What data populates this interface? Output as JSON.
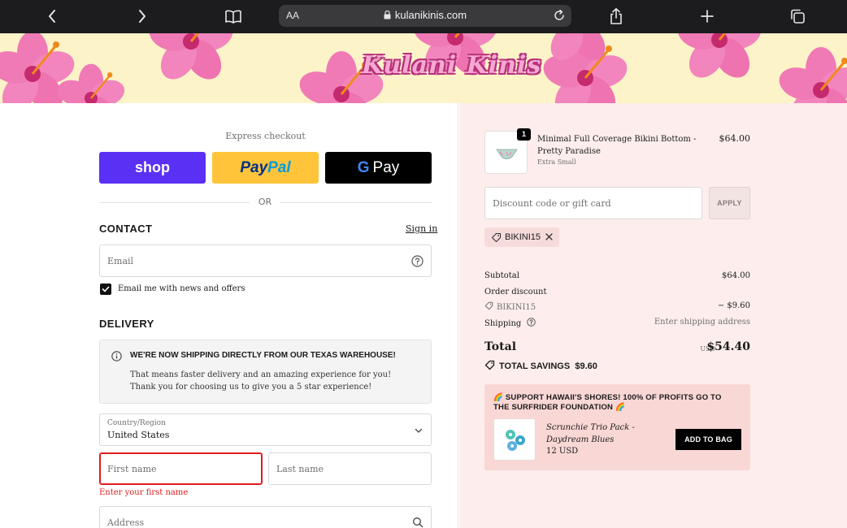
{
  "browser": {
    "url": "kulanikinis.com",
    "text_size_label": "AA"
  },
  "banner": {
    "logo_text": "Kulani Kinis"
  },
  "checkout": {
    "express_label": "Express checkout",
    "shop_label": "shop",
    "paypal_label_pay": "Pay",
    "paypal_label_pal": "Pal",
    "gpay_label_g": "G",
    "gpay_label_pay": "Pay",
    "or_label": "OR",
    "contact": {
      "heading": "CONTACT",
      "sign_in": "Sign in",
      "email_placeholder": "Email",
      "newsletter_label": "Email me with news and offers",
      "newsletter_checked": true
    },
    "delivery": {
      "heading": "DELIVERY",
      "notice_title": "WE'RE NOW SHIPPING DIRECTLY FROM OUR TEXAS WAREHOUSE!",
      "notice_body": "That means faster delivery and an amazing experience for you! Thank you for choosing us to give you a 5 star experience!",
      "country_label": "Country/Region",
      "country_value": "United States",
      "first_name_placeholder": "First name",
      "last_name_placeholder": "Last name",
      "first_name_error": "Enter your first name",
      "address_placeholder": "Address"
    }
  },
  "summary": {
    "item": {
      "quantity": "1",
      "name": "Minimal Full Coverage Bikini Bottom - Pretty Paradise",
      "variant": "Extra Small",
      "price": "$64.00"
    },
    "discount_placeholder": "Discount code or gift card",
    "apply_label": "APPLY",
    "applied_code": "BIKINI15",
    "subtotal_label": "Subtotal",
    "subtotal_value": "$64.00",
    "order_discount_label": "Order discount",
    "order_discount_code": "BIKINI15",
    "order_discount_value": "− $9.60",
    "shipping_label": "Shipping",
    "shipping_value": "Enter shipping address",
    "total_label": "Total",
    "total_currency": "USD",
    "total_value": "$54.40",
    "savings_label": "TOTAL SAVINGS",
    "savings_value": "$9.60",
    "upsell": {
      "title": "🌈 SUPPORT HAWAII'S SHORES! 100% OF PROFITS GO TO THE SURFRIDER FOUNDATION 🌈",
      "product_name": "Scrunchie Trio Pack - Daydream Blues",
      "product_price": "12 USD",
      "add_label": "ADD TO BAG"
    }
  },
  "colors": {
    "shop_pay": "#5a31f4",
    "paypal": "#ffc439",
    "error": "#dd1d1d",
    "summary_bg": "#fdeeed"
  }
}
